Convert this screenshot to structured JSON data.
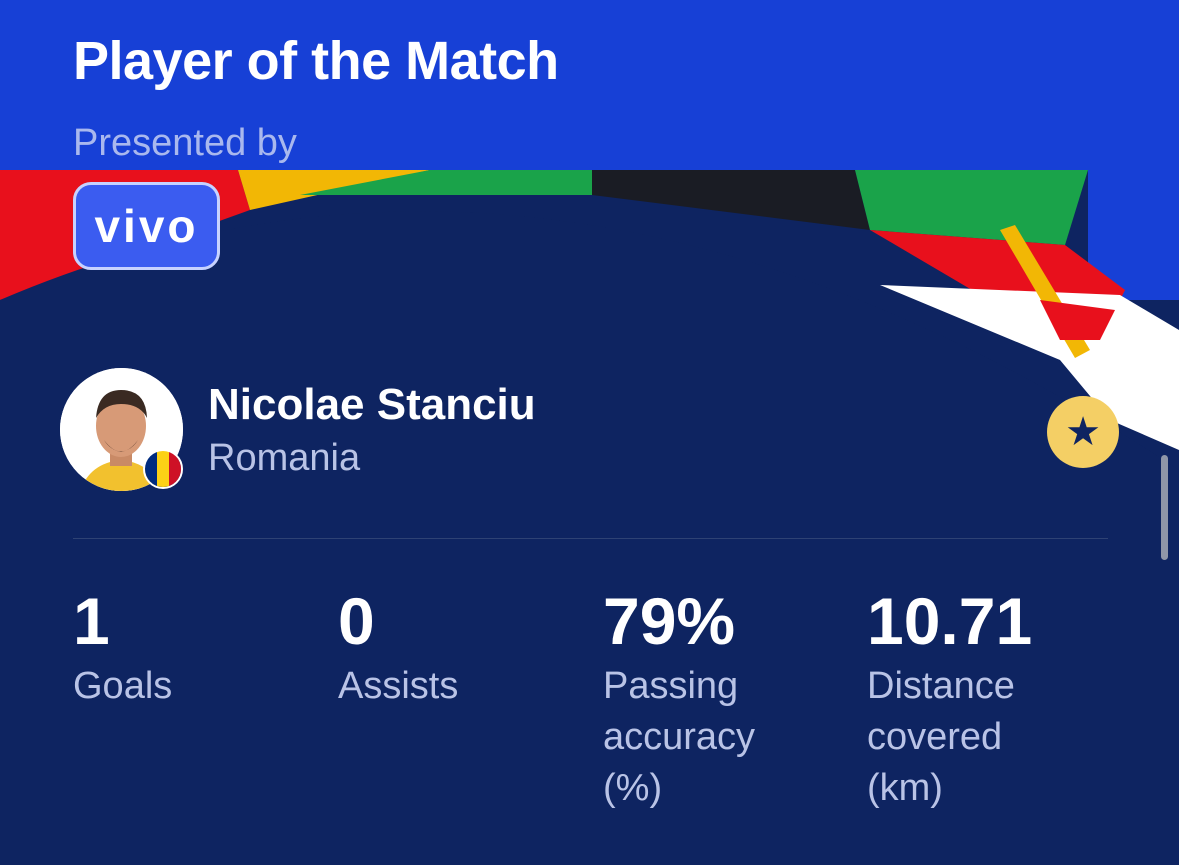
{
  "header": {
    "title": "Player of the Match",
    "presented_by": "Presented by",
    "sponsor_logo_text": "vivo"
  },
  "player": {
    "name": "Nicolae Stanciu",
    "country": "Romania",
    "flag_colors": [
      "#002b7f",
      "#fcd116",
      "#ce1126"
    ]
  },
  "favorite": {
    "icon": "star-icon"
  },
  "stats": [
    {
      "value": "1",
      "label": "Goals"
    },
    {
      "value": "0",
      "label": "Assists"
    },
    {
      "value": "79%",
      "label": "Passing accuracy (%)"
    },
    {
      "value": "10.71",
      "label": "Distance covered (km)"
    }
  ],
  "colors": {
    "header_blue": "#1740d6",
    "card_navy": "#0e2461",
    "accent_yellow": "#f4cf65"
  }
}
